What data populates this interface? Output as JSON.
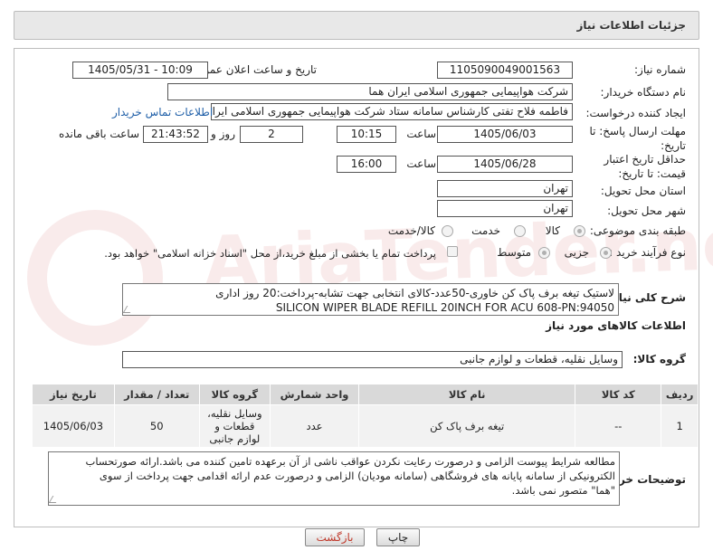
{
  "header": {
    "title": "جزئیات اطلاعات نیاز"
  },
  "form": {
    "need_number_label": "شماره نیاز:",
    "need_number": "1105090049001563",
    "announce_label": "تاریخ و ساعت اعلان عمومی:",
    "announce_value": "1405/05/31 - 10:09",
    "buyer_org_label": "نام دستگاه خریدار:",
    "buyer_org": "شرکت هواپیمایی جمهوری اسلامی ایران هما",
    "creator_label": "ایجاد کننده درخواست:",
    "creator": "فاطمه فلاح تفتی کارشناس سامانه ستاد شرکت هواپیمایی جمهوری اسلامی ایران",
    "contact_link": "اطلاعات تماس خریدار",
    "send_deadline_label": "مهلت ارسال پاسخ: تا تاریخ:",
    "send_date": "1405/06/03",
    "time_label": "ساعت",
    "send_time": "10:15",
    "days_value": "2",
    "days_label": "روز و",
    "remaining_time": "21:43:52",
    "remaining_label": "ساعت باقی مانده",
    "price_validity_label": "حداقل تاریخ اعتبار قیمت: تا تاریخ:",
    "price_date": "1405/06/28",
    "price_time": "16:00",
    "province_label": "استان محل تحویل:",
    "province": "تهران",
    "city_label": "شهر محل تحویل:",
    "city": "تهران",
    "category_label": "طبقه بندی موضوعی:",
    "category_options": [
      "کالا",
      "خدمت",
      "کالا/خدمت"
    ],
    "category_selected": "کالا",
    "process_label": "نوع فرآیند خرید :",
    "process_options": [
      "جزیی",
      "متوسط"
    ],
    "process_selected": "جزیی",
    "payment_note": "پرداخت تمام یا بخشی از مبلغ خرید،از محل \"اسناد خزانه اسلامی\" خواهد بود.",
    "description_label": "شرح کلی نیاز:",
    "description_line1": "لاستیک تیغه برف پاک کن خاوری-50عدد-کالای انتخابی جهت تشابه-پرداخت:20 روز اداری",
    "description_line2": "SILICON WIPER BLADE REFILL 20INCH FOR ACU 608-PN:94050",
    "goods_info_title": "اطلاعات کالاهای مورد نیاز",
    "goods_group_label": "گروه کالا:",
    "goods_group": "وسایل نقلیه، قطعات و لوازم جانبی"
  },
  "table": {
    "headers": [
      "ردیف",
      "کد کالا",
      "نام کالا",
      "واحد شمارش",
      "گروه کالا",
      "تعداد / مقدار",
      "تاریخ نیاز"
    ],
    "rows": [
      [
        "1",
        "--",
        "تیغه برف پاک کن",
        "عدد",
        "وسایل نقلیه، قطعات و لوازم جانبی",
        "50",
        "1405/06/03"
      ]
    ]
  },
  "buyer_notes": {
    "label": "توضیحات خریدار:",
    "line1": "مطالعه شرایط پیوست الزامی و درصورت رعایت نکردن عواقب ناشی از آن برعهده تامین کننده می باشد.ارائه صورتحساب",
    "line2": "الکترونیکی از سامانه پایانه های فروشگاهی (سامانه مودیان) الزامی و درصورت عدم ارائه اقدامی جهت پرداخت از سوی",
    "line3": "\"هما\" متصور نمی باشد."
  },
  "buttons": {
    "print": "چاپ",
    "back": "بازگشت"
  },
  "watermark": "AriaTender.net",
  "colors": {
    "link": "#1f5fa8",
    "back_text": "#c0392b"
  }
}
